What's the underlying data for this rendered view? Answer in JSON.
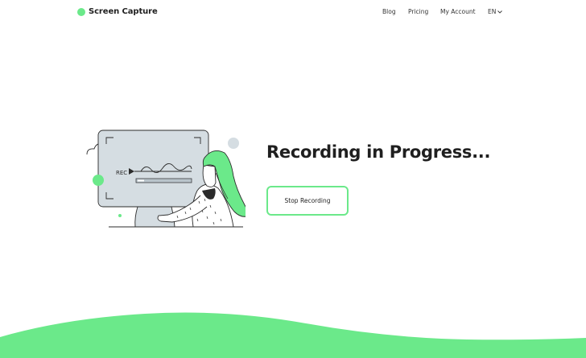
{
  "brand": {
    "name": "Screen Capture",
    "accent_color": "#6be98a"
  },
  "nav": {
    "items": [
      {
        "label": "Blog"
      },
      {
        "label": "Pricing"
      },
      {
        "label": "My Account"
      }
    ],
    "language": "EN",
    "language_icon": "chevron-down-icon"
  },
  "illustration": {
    "screen_label": "REC",
    "icons": [
      "cloud-icon",
      "play-icon",
      "progress-bar",
      "person-illustration"
    ]
  },
  "hero": {
    "title": "Recording in Progress...",
    "button_label": "Stop Recording"
  }
}
